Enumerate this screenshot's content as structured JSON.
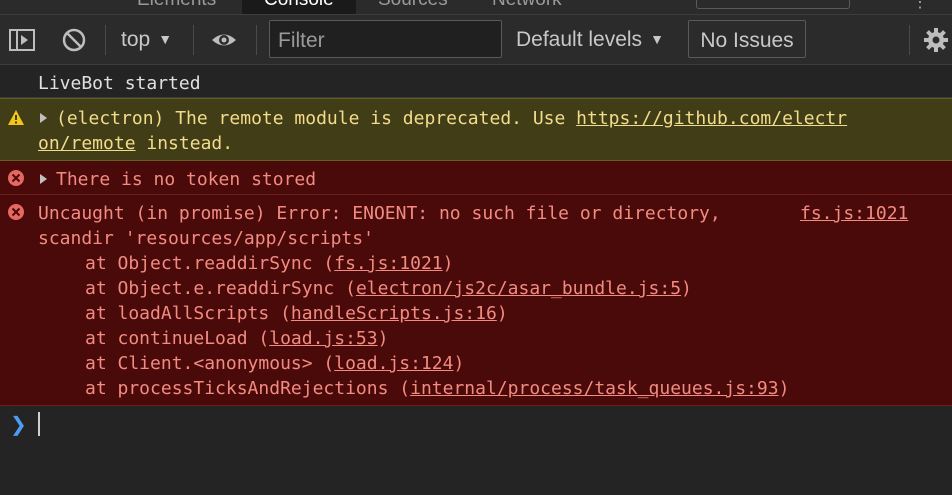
{
  "tabs": [
    "Elements",
    "Console",
    "Sources",
    "Network"
  ],
  "active_tab": "Console",
  "toolbar": {
    "context": "top",
    "filter_placeholder": "Filter",
    "levels": "Default levels",
    "issues": "No Issues"
  },
  "icons": {
    "sidebar": "sidebar-toggle-icon",
    "clear": "clear-console-icon",
    "eye": "live-expression-eye-icon",
    "settings": "gear-icon",
    "warning": "warning-icon",
    "error": "error-icon",
    "expand": "expand-triangle-icon",
    "prompt": "prompt-chevron-icon"
  },
  "colors": {
    "warning_bg": "#413d16",
    "warning_text": "#f3dc8c",
    "error_bg": "#4a0a0a",
    "error_text": "#f28b82",
    "prompt": "#4e9cf0"
  },
  "messages": {
    "plain": "LiveBot started",
    "warning": {
      "prefix": "(electron) The remote module is deprecated. Use ",
      "link_part1": "https://github.com/electr",
      "link_part2": "on/remote",
      "suffix": " instead."
    },
    "error1": "There is no token stored",
    "error2": {
      "line1": "Uncaught (in promise) Error: ENOENT: no such file or directory,",
      "line2": "scandir 'resources/app/scripts'",
      "source": "fs.js:1021",
      "stack": [
        {
          "fn": "at Object.readdirSync (",
          "link": "fs.js:1021",
          "end": ")"
        },
        {
          "fn": "at Object.e.readdirSync (",
          "link": "electron/js2c/asar_bundle.js:5",
          "end": ")"
        },
        {
          "fn": "at loadAllScripts (",
          "link": "handleScripts.js:16",
          "end": ")"
        },
        {
          "fn": "at continueLoad (",
          "link": "load.js:53",
          "end": ")"
        },
        {
          "fn": "at Client.<anonymous> (",
          "link": "load.js:124",
          "end": ")"
        },
        {
          "fn": "at processTicksAndRejections (",
          "link": "internal/process/task_queues.js:93",
          "end": ")"
        }
      ]
    }
  }
}
